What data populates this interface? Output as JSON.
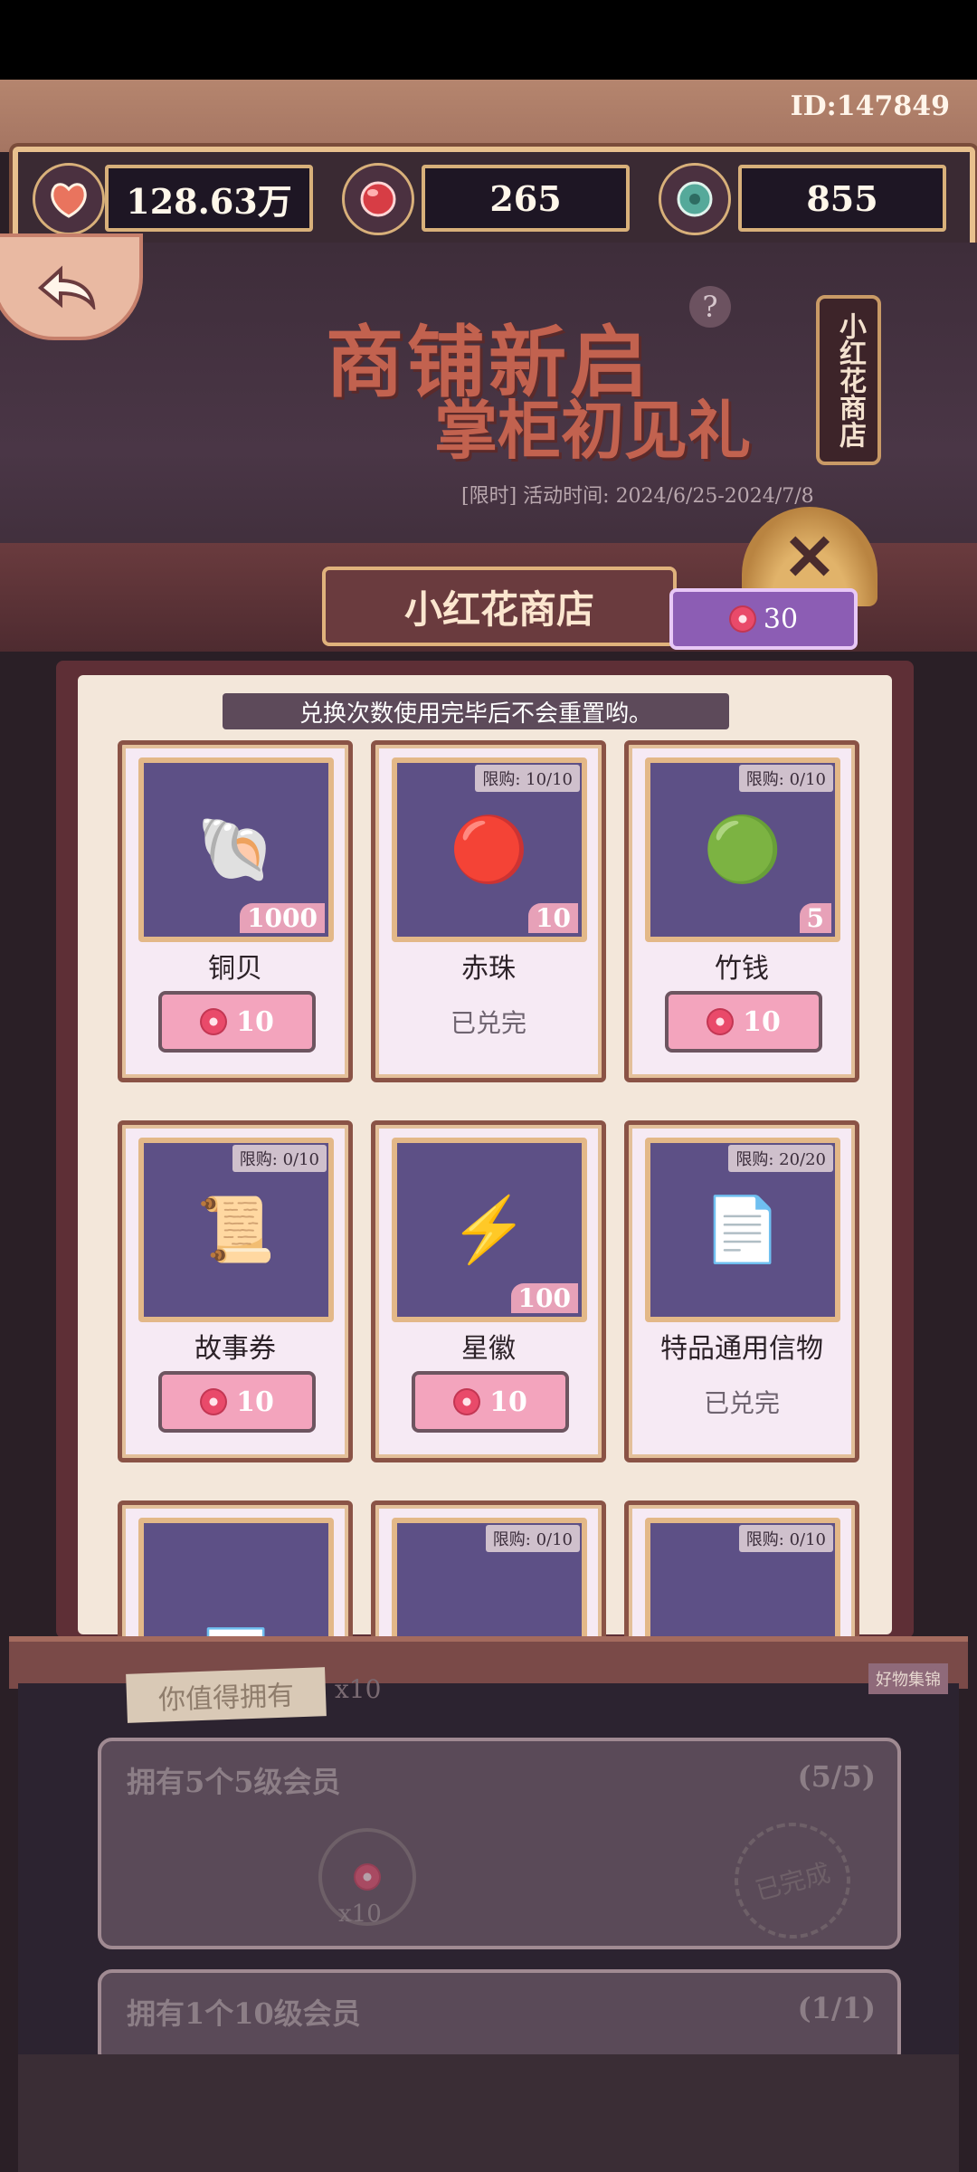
{
  "user": {
    "id_text": "ID:147849"
  },
  "currencies": [
    {
      "icon": "copper-shell-icon",
      "value": "128.63万"
    },
    {
      "icon": "red-pearl-icon",
      "value": "265"
    },
    {
      "icon": "bamboo-coin-icon",
      "value": "855"
    }
  ],
  "banner": {
    "title_line1": "商铺新启",
    "title_line2": "掌柜初见礼",
    "time_label": "[限时] 活动时间: 2024/6/25-2024/7/8",
    "shop_sign": "小红花商店"
  },
  "shop": {
    "title": "小红花商店",
    "flower_balance": "30",
    "notice": "兑换次数使用完毕后不会重置哟。",
    "items": [
      {
        "name": "铜贝",
        "limit": "",
        "qty": "1000",
        "price": "10",
        "status": "buy",
        "icon": "copper-shell-icon",
        "glyph": "🐚"
      },
      {
        "name": "赤珠",
        "limit": "限购: 10/10",
        "qty": "10",
        "price": "",
        "status": "已兑完",
        "icon": "red-pearl-icon",
        "glyph": "🔴"
      },
      {
        "name": "竹钱",
        "limit": "限购: 0/10",
        "qty": "5",
        "price": "10",
        "status": "buy",
        "icon": "bamboo-coin-icon",
        "glyph": "🟢"
      },
      {
        "name": "故事券",
        "limit": "限购: 0/10",
        "qty": "",
        "price": "10",
        "status": "buy",
        "icon": "story-ticket-icon",
        "glyph": "📜"
      },
      {
        "name": "星徽",
        "limit": "",
        "qty": "100",
        "price": "10",
        "status": "buy",
        "icon": "star-badge-icon",
        "glyph": "⚡"
      },
      {
        "name": "特品通用信物",
        "limit": "限购: 20/20",
        "qty": "",
        "price": "",
        "status": "已兑完",
        "icon": "token-paper-icon",
        "glyph": "📄"
      },
      {
        "name": "",
        "limit": "",
        "qty": "",
        "price": "",
        "status": "",
        "icon": "scroll-icon",
        "glyph": "📃"
      },
      {
        "name": "",
        "limit": "限购: 0/10",
        "qty": "",
        "price": "",
        "status": "",
        "icon": "arrow-icon",
        "glyph": "➶"
      },
      {
        "name": "",
        "limit": "限购: 0/10",
        "qty": "",
        "price": "",
        "status": "",
        "icon": "item-icon",
        "glyph": ""
      }
    ]
  },
  "background_tasks": [
    {
      "label": "拥有5个5级会员",
      "progress": "(5/5)",
      "reward": "x10",
      "stamp": "已完成"
    },
    {
      "label": "拥有1个10级会员",
      "progress": "(1/1)"
    }
  ],
  "bg_misc": {
    "tag": "你值得拥有",
    "reward_top": "x10",
    "side_text": "好物集锦"
  }
}
